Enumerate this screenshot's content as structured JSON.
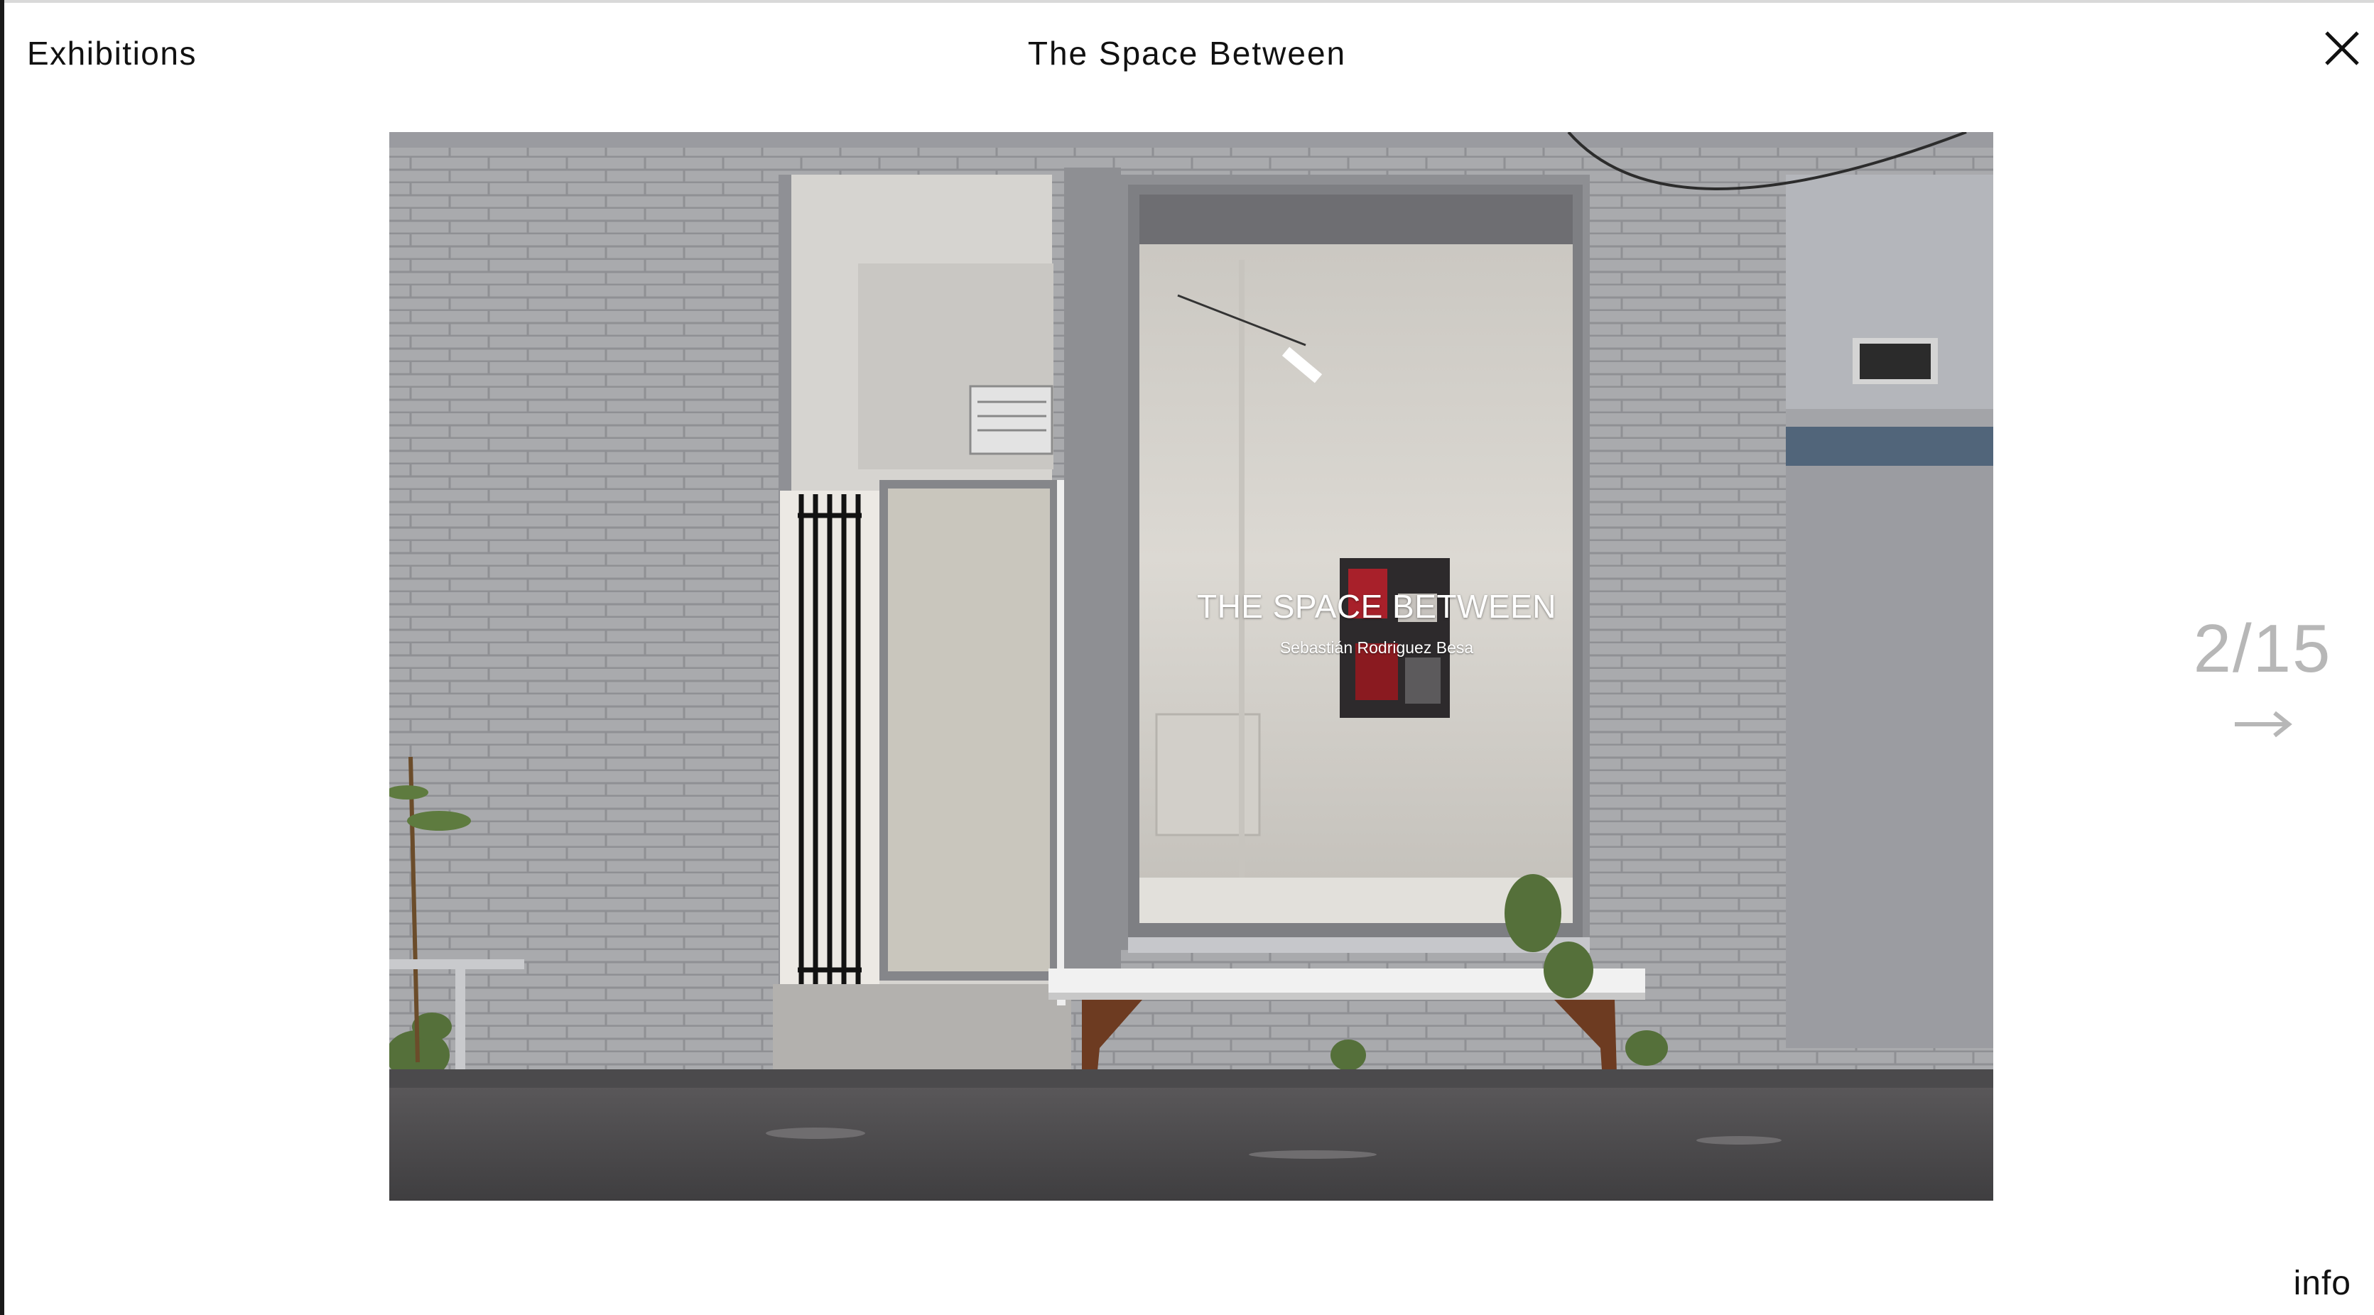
{
  "header": {
    "nav_label": "Exhibitions",
    "title": "The Space Between"
  },
  "slideshow": {
    "counter": "2/15",
    "info_label": "info"
  },
  "photo": {
    "window_text_title": "THE SPACE BETWEEN",
    "window_text_subtitle": "Sebastián Rodriguez Besa"
  },
  "icons": {
    "close": "close-icon",
    "next": "arrow-right-icon"
  },
  "colors": {
    "text": "#111111",
    "counter": "#b7b7b7",
    "background": "#ffffff"
  }
}
